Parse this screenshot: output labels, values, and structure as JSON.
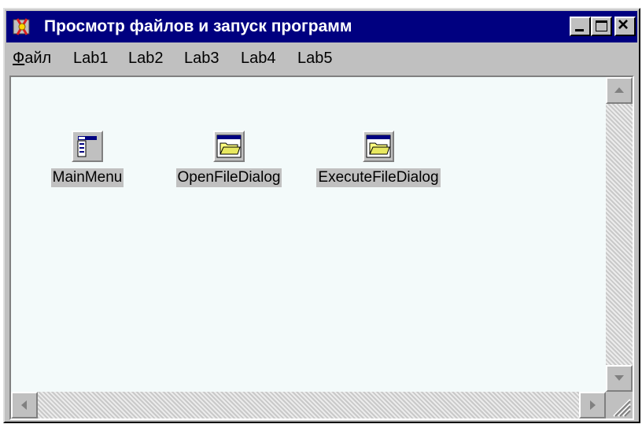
{
  "window": {
    "title": "Просмотр файлов и запуск программ",
    "icon": "app-icon"
  },
  "menu": {
    "items": [
      {
        "label": "Файл",
        "accel": "Ф",
        "rest": "айл"
      },
      {
        "label": "Lab1"
      },
      {
        "label": "Lab2"
      },
      {
        "label": "Lab3"
      },
      {
        "label": "Lab4"
      },
      {
        "label": "Lab5"
      }
    ]
  },
  "components": [
    {
      "label": "MainMenu",
      "icon": "main-menu-icon"
    },
    {
      "label": "OpenFileDialog",
      "icon": "folder-dialog-icon"
    },
    {
      "label": "ExecuteFileDialog",
      "icon": "folder-dialog-icon"
    }
  ]
}
